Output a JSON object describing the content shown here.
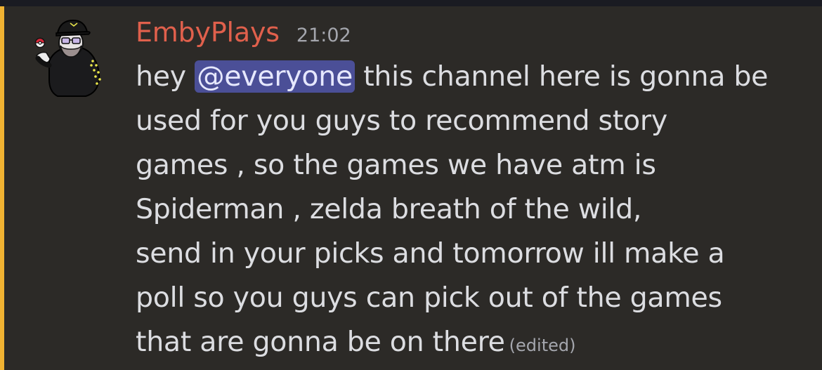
{
  "message": {
    "author": "EmbyPlays",
    "timestamp": "21:02",
    "lines": {
      "l1_before": "hey ",
      "mention": "@everyone",
      "l1_after": " this channel here is gonna be",
      "l2": "used for you guys to recommend story",
      "l3": "games , so the games we have atm is",
      "l4": "Spiderman , zelda breath of the wild,",
      "l5": "send in your picks and tomorrow ill make a",
      "l6": "poll so you guys can pick out of the games",
      "l7": "that are gonna be on there"
    },
    "edited_label": "(edited)"
  },
  "colors": {
    "author": "#e0604c",
    "mention_bg": "#4b4f97",
    "highlight_bar": "#f0b232",
    "text": "#dcdde1",
    "muted": "#a4a6ad",
    "background": "#2c2a27"
  },
  "icons": {
    "avatar": "user-avatar-cartoon-with-pokeball"
  }
}
